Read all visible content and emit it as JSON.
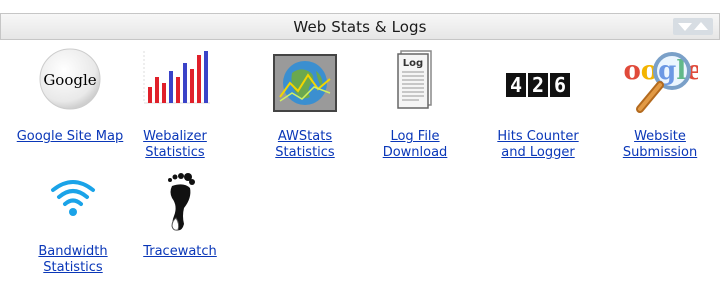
{
  "panel": {
    "title": "Web Stats & Logs"
  },
  "items": [
    {
      "label": "Google Site Map",
      "icon": "google-logo-icon"
    },
    {
      "label": "Webalizer\nStatistics",
      "icon": "bar-chart-icon"
    },
    {
      "label": "AWStats\nStatistics",
      "icon": "globe-chart-icon"
    },
    {
      "label": "Log File\nDownload",
      "icon": "log-document-icon"
    },
    {
      "label": "Hits Counter\nand Logger",
      "icon": "counter-icon"
    },
    {
      "label": "Website\nSubmission",
      "icon": "google-magnifier-icon"
    },
    {
      "label": "Bandwidth\nStatistics",
      "icon": "wifi-icon"
    },
    {
      "label": "Tracewatch",
      "icon": "footprint-icon"
    }
  ],
  "counter": {
    "digits": [
      "4",
      "2",
      "6"
    ]
  },
  "log_icon_text": "Log",
  "google_text": "Google",
  "colors": {
    "link": "#0a37b8",
    "header_bg": "#eeeeee",
    "header_border": "#c6c6c6",
    "collapse_button": "#d7dde3",
    "wifi": "#1aa3e8"
  }
}
